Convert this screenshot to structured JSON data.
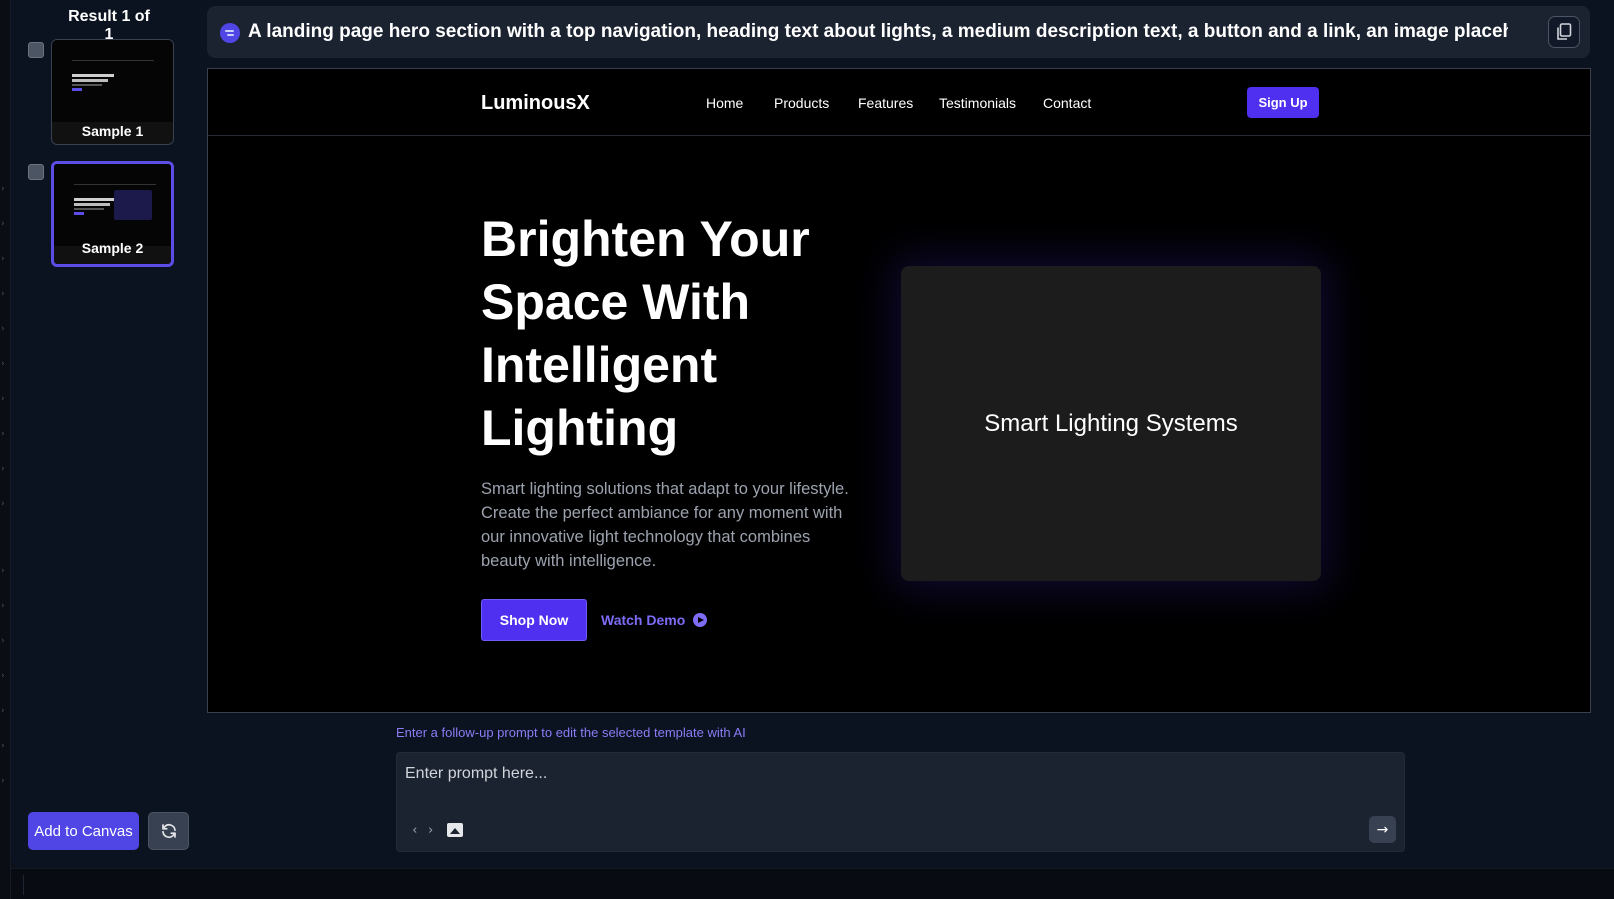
{
  "sidebar": {
    "result_title": "Result 1 of 1",
    "samples": [
      {
        "label": "Sample 1",
        "selected": false
      },
      {
        "label": "Sample 2",
        "selected": true
      }
    ],
    "add_button": "Add to Canvas",
    "refresh_icon": "refresh-icon"
  },
  "prompt": {
    "text": "A landing page hero section with a top navigation, heading text about lights, a medium description text, a button and a link, an image placeholder. Use...",
    "copy_icon": "copy-icon"
  },
  "preview": {
    "brand": "LuminousX",
    "nav": [
      "Home",
      "Products",
      "Features",
      "Testimonials",
      "Contact"
    ],
    "signup": "Sign Up",
    "hero_title_lines": [
      "Brighten Your",
      "Space With",
      "Intelligent",
      "Lighting"
    ],
    "hero_desc": "Smart lighting solutions that adapt to your lifestyle. Create the perfect ambiance for any moment with our innovative light technology that combines beauty with intelligence.",
    "shop_button": "Shop Now",
    "watch_demo": "Watch Demo",
    "image_placeholder": "Smart Lighting Systems"
  },
  "followup": {
    "label": "Enter a follow-up prompt to edit the selected template with AI",
    "placeholder": "Enter prompt here...",
    "code_icon": "code-icon",
    "image_icon": "image-icon",
    "send_icon": "arrow-right-icon"
  },
  "colors": {
    "accent": "#4f46e5",
    "brand_button": "#4f2ff0",
    "link": "#7c6cf6",
    "panel": "#0b1220"
  }
}
